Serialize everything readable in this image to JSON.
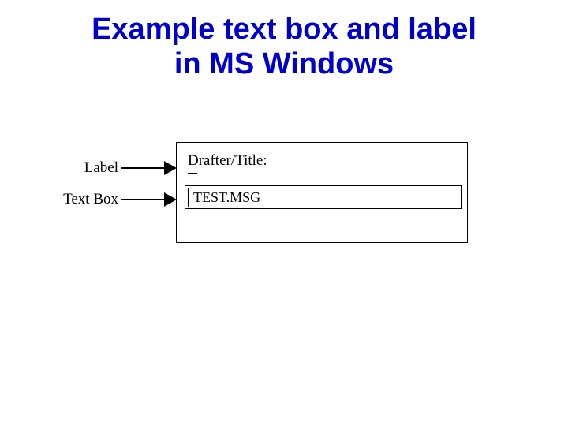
{
  "title_line1": "Example text box and label",
  "title_line2": "in MS Windows",
  "callouts": {
    "label": "Label",
    "textbox": "Text Box"
  },
  "panel": {
    "field_label": "Drafter/Title:",
    "textbox_value": "TEST.MSG"
  }
}
